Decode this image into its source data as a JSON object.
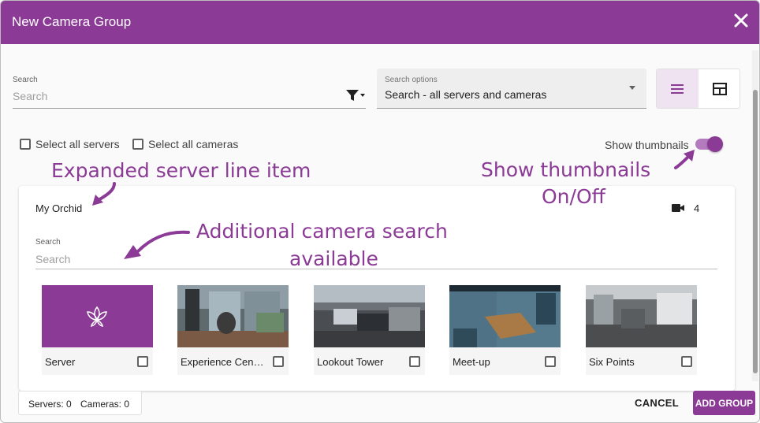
{
  "dialog": {
    "title": "New Camera Group",
    "close_icon": "close-icon"
  },
  "search": {
    "label": "Search",
    "placeholder": "Search",
    "filter_icon": "filter-icon"
  },
  "search_options": {
    "label": "Search options",
    "value": "Search - all servers and cameras"
  },
  "view_toggle": {
    "list_icon": "list-view-icon",
    "grid_icon": "table-view-icon",
    "active": "list"
  },
  "selection": {
    "select_all_servers": "Select all servers",
    "select_all_cameras": "Select all cameras",
    "show_thumbnails_label": "Show thumbnails",
    "show_thumbnails_on": true
  },
  "annotations": {
    "expanded_server": "Expanded server line item",
    "show_thumbnails_line1": "Show thumbnails",
    "show_thumbnails_line2": "On/Off",
    "camera_search_line1": "Additional camera search",
    "camera_search_line2": "available"
  },
  "server": {
    "name": "My Orchid",
    "camera_icon": "video-camera-icon",
    "camera_count": "4",
    "search_label": "Search",
    "search_placeholder": "Search",
    "tiles": [
      {
        "label": "Server",
        "kind": "server"
      },
      {
        "label": "Experience Center ...",
        "kind": "camera"
      },
      {
        "label": "Lookout Tower",
        "kind": "camera"
      },
      {
        "label": "Meet-up",
        "kind": "camera"
      },
      {
        "label": "Six Points",
        "kind": "camera"
      }
    ]
  },
  "footer": {
    "servers": "Servers: 0",
    "cameras": "Cameras: 0",
    "cancel": "CANCEL",
    "add_group": "ADD GROUP"
  },
  "colors": {
    "accent": "#8b3a96",
    "accent_light": "#efe3f1"
  }
}
